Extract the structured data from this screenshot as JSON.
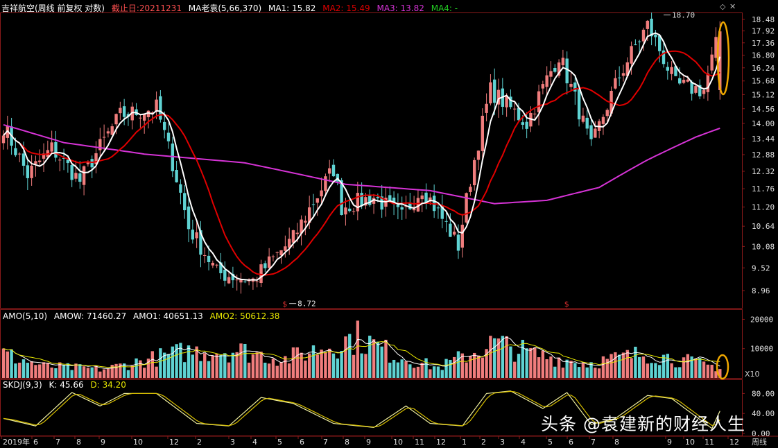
{
  "header": {
    "stock": "吉祥航空(周线 前复权 对数)",
    "cutoff_label": "截止日:20211231",
    "ma_name": "MA老袁(5,66,370)",
    "ma1": "MA1: 15.82",
    "ma2": "MA2: 15.49",
    "ma3": "MA3: 13.82",
    "ma4": "MA4: -"
  },
  "amo_header": {
    "name": "AMO(5,10)",
    "amow": "AMOW: 71460.27",
    "amo1": "AMO1: 40651.13",
    "amo2": "AMO2: 50612.38"
  },
  "kdj_header": {
    "name": "SKDJ(9,3)",
    "k": "K: 45.66",
    "d": "D: 34.20"
  },
  "colors": {
    "up": "#f07d7d",
    "down": "#5fd3d3",
    "ma1": "#ffffff",
    "ma2": "#e00000",
    "ma3": "#d633d6",
    "ma4": "#22cc22",
    "highlight": "#f0a800",
    "k_line": "#f0f0a0",
    "d_line": "#d8c000"
  },
  "watermark": "头条 @袁建新的财经人生",
  "period_label": "周线",
  "x10_label": "X10",
  "chart_data": [
    {
      "type": "candlestick",
      "title": "吉祥航空(周线 前复权 对数)",
      "scale": "log",
      "y_ticks": [
        "18.48",
        "17.92",
        "17.36",
        "16.80",
        "16.24",
        "15.68",
        "15.12",
        "14.56",
        "14.00",
        "13.44",
        "12.88",
        "12.32",
        "11.76",
        "11.20",
        "10.64",
        "10.08",
        "9.52",
        "8.96"
      ],
      "annotations": [
        {
          "text": "18.70",
          "kind": "high",
          "value": 18.7
        },
        {
          "text": "8.72",
          "kind": "low",
          "value": 8.72
        }
      ],
      "x_labels": [
        "2019年",
        "6",
        "7",
        "8",
        "9",
        "10",
        "12",
        "2",
        "3",
        "4",
        "5",
        "6",
        "7",
        "8",
        "9",
        "10",
        "11",
        "12",
        "1",
        "2",
        "3",
        "4",
        "5",
        "6",
        "7",
        "8",
        "9",
        "10",
        "11",
        "12"
      ],
      "ma1_last": 15.82,
      "ma2_last": 15.49,
      "ma3_last": 13.82,
      "close_pivots": [
        [
          0,
          13.9
        ],
        [
          6,
          12.2
        ],
        [
          12,
          13.1
        ],
        [
          19,
          12.0
        ],
        [
          29,
          14.3
        ],
        [
          38,
          14.6
        ],
        [
          46,
          10.6
        ],
        [
          53,
          9.4
        ],
        [
          62,
          9.2
        ],
        [
          72,
          10.3
        ],
        [
          82,
          12.4
        ],
        [
          84,
          11.2
        ],
        [
          92,
          11.5
        ],
        [
          99,
          10.9
        ],
        [
          104,
          11.8
        ],
        [
          113,
          10.1
        ],
        [
          121,
          15.3
        ],
        [
          130,
          14.0
        ],
        [
          138,
          16.8
        ],
        [
          146,
          13.1
        ],
        [
          153,
          15.9
        ],
        [
          160,
          18.2
        ],
        [
          167,
          15.5
        ],
        [
          174,
          15.3
        ],
        [
          178,
          17.9
        ]
      ],
      "ma3_pivots": [
        [
          0,
          13.95
        ],
        [
          15,
          13.3
        ],
        [
          35,
          12.9
        ],
        [
          60,
          12.6
        ],
        [
          85,
          11.9
        ],
        [
          106,
          11.7
        ],
        [
          122,
          11.3
        ],
        [
          135,
          11.4
        ],
        [
          148,
          11.8
        ],
        [
          160,
          12.7
        ],
        [
          172,
          13.5
        ],
        [
          178,
          13.82
        ]
      ]
    },
    {
      "type": "bar",
      "title": "AMO(5,10)",
      "y_ticks": [
        "20000",
        "10000"
      ],
      "amow": 71460.27,
      "amo1": 40651.13,
      "amo2": 50612.38,
      "volume_pivots": [
        [
          0,
          8200
        ],
        [
          10,
          4000
        ],
        [
          25,
          3000
        ],
        [
          45,
          9000
        ],
        [
          58,
          9500
        ],
        [
          70,
          6500
        ],
        [
          88,
          14000
        ],
        [
          97,
          8000
        ],
        [
          108,
          3500
        ],
        [
          122,
          12000
        ],
        [
          132,
          8000
        ],
        [
          145,
          5000
        ],
        [
          160,
          8500
        ],
        [
          178,
          3500
        ]
      ]
    },
    {
      "type": "line",
      "title": "SKDJ(9,3)",
      "y_ticks": [
        "80.00",
        "40.00",
        "0.00"
      ],
      "k_last": 45.66,
      "d_last": 34.2,
      "k_pivots": [
        [
          0,
          30
        ],
        [
          8,
          15
        ],
        [
          17,
          82
        ],
        [
          24,
          55
        ],
        [
          30,
          80
        ],
        [
          38,
          80
        ],
        [
          48,
          20
        ],
        [
          56,
          15
        ],
        [
          64,
          72
        ],
        [
          72,
          60
        ],
        [
          82,
          20
        ],
        [
          92,
          12
        ],
        [
          100,
          55
        ],
        [
          106,
          20
        ],
        [
          114,
          15
        ],
        [
          120,
          80
        ],
        [
          126,
          85
        ],
        [
          134,
          50
        ],
        [
          140,
          82
        ],
        [
          146,
          18
        ],
        [
          152,
          30
        ],
        [
          160,
          76
        ],
        [
          166,
          70
        ],
        [
          176,
          10
        ],
        [
          178,
          45
        ]
      ]
    }
  ]
}
